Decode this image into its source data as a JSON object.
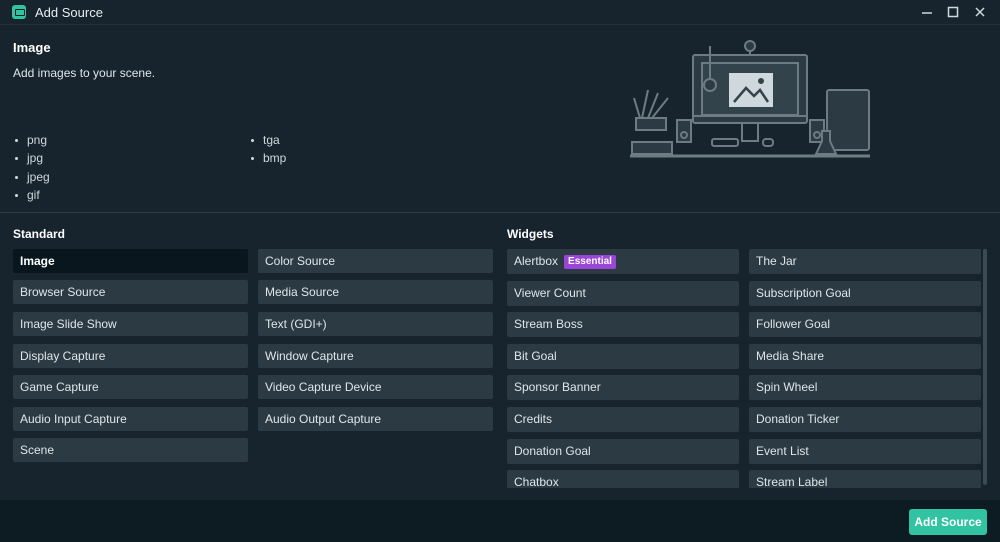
{
  "window": {
    "title": "Add Source",
    "icons": {
      "app": "streamlabs-icon",
      "minimize": "minimize-icon",
      "maximize": "maximize-icon",
      "close": "close-icon"
    }
  },
  "selected_source": {
    "title": "Image",
    "description": "Add images to your scene.",
    "formats_col1": [
      "png",
      "jpg",
      "jpeg",
      "gif"
    ],
    "formats_col2": [
      "tga",
      "bmp"
    ]
  },
  "standard": {
    "heading": "Standard",
    "col1": [
      "Image",
      "Browser Source",
      "Image Slide Show",
      "Display Capture",
      "Game Capture",
      "Audio Input Capture",
      "Scene"
    ],
    "col2": [
      "Color Source",
      "Media Source",
      "Text (GDI+)",
      "Window Capture",
      "Video Capture Device",
      "Audio Output Capture"
    ],
    "active": "Image"
  },
  "widgets": {
    "heading": "Widgets",
    "badge": "Essential",
    "col1": [
      "Alertbox",
      "Viewer Count",
      "Stream Boss",
      "Bit Goal",
      "Sponsor Banner",
      "Credits",
      "Donation Goal",
      "Chatbox"
    ],
    "col2": [
      "The Jar",
      "Subscription Goal",
      "Follower Goal",
      "Media Share",
      "Spin Wheel",
      "Donation Ticker",
      "Event List",
      "Stream Label"
    ]
  },
  "footer": {
    "add_label": "Add Source"
  },
  "colors": {
    "accent": "#31c3a2",
    "badge": "#9b44d8",
    "item_bg": "#2b3a43",
    "active_bg": "#09161d"
  }
}
